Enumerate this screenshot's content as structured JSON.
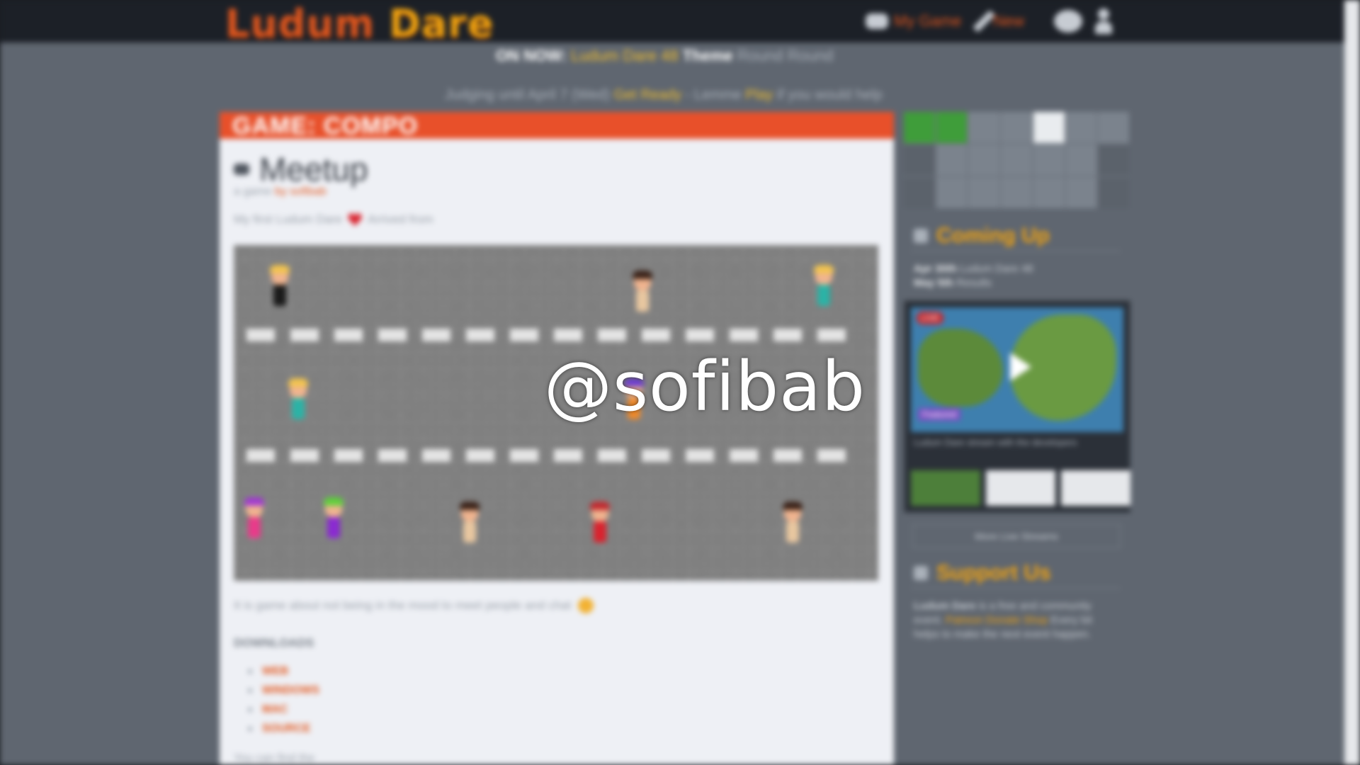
{
  "site": {
    "logo_ludum": "Ludum",
    "logo_dare": "Dare"
  },
  "nav": {
    "games_label": "My Game",
    "new_label": "New"
  },
  "announcement": {
    "on_now": "ON NOW:",
    "event": "Ludum Dare 48",
    "phase": "Theme",
    "rest": "Round Round",
    "line2_a": "Judging until April 7 (Wed)",
    "line2_link1": "Get Ready",
    "line2_b": "- Lemme",
    "line2_link2": "Play",
    "line2_c": "if you would help"
  },
  "game": {
    "section_label": "GAME: COMPO",
    "title": "Meetup",
    "byline_prefix": "a game",
    "author": "by sofibab",
    "tagline_a": "My first Ludum Dare",
    "tagline_b": "Arrived from",
    "description": "It is game about not being in the mood to meet people and chat",
    "downloads_heading": "DOWNLOADS",
    "downloads": [
      "WEB",
      "WINDOWS",
      "MAC",
      "SOURCE"
    ],
    "footnote": "You can find the"
  },
  "sidebar": {
    "coming_up": "Coming Up",
    "coming_line1_label": "Apr 30th",
    "coming_line1": "Ludum Dare 48",
    "coming_line2_label": "May 5th",
    "coming_line2": "Results",
    "video_live": "LIVE",
    "video_category": "Featured",
    "video_title": "Ludum Dare stream with the developers",
    "more_streams": "More Live Streams",
    "support_us": "Support Us",
    "support_a": "Ludum Dare",
    "support_b": "is a free and community event.",
    "support_link1": "Patreon",
    "support_link2": "Donate",
    "support_link3": "Shop",
    "support_c": "Every bit helps to make the next event happen."
  },
  "watermark": "@sofibab",
  "colors": {
    "brand_orange": "#e2571e",
    "brand_yellow": "#f2a30f",
    "header_bg": "#1c2027"
  },
  "icons": [
    "gamepad-icon",
    "pencil-icon",
    "chat-bubble-icon",
    "user-icon",
    "heart-icon",
    "play-icon"
  ]
}
